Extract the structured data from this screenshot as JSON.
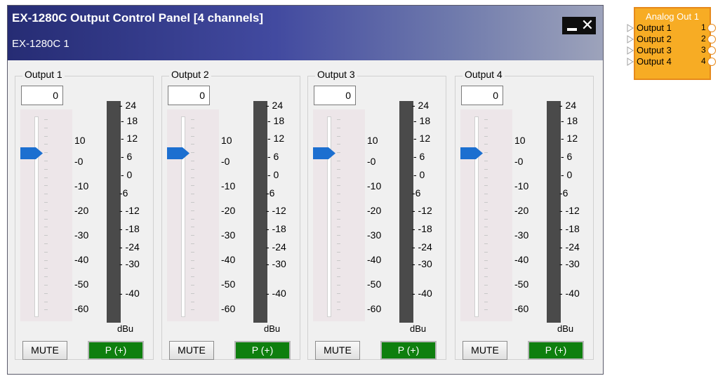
{
  "window": {
    "title": "EX-1280C Output Control Panel [4 channels]",
    "subtitle": "EX-1280C 1",
    "minimize_icon": "minimize-icon",
    "close_icon": "close-icon",
    "close_glyph": "✕"
  },
  "fader_scale": [
    "10",
    "-0",
    "-10",
    "-20",
    "-30",
    "-40",
    "-50",
    "-60"
  ],
  "meter_scale": [
    "- 24",
    "- 18",
    "- 12",
    "- 6",
    "- 0",
    "-6",
    "- -12",
    "- -18",
    "- -24",
    "- -30",
    "- -40"
  ],
  "meter_unit": "dBu",
  "colors": {
    "title_bar_start": "#262c74",
    "meter": "#4a4a4a",
    "polarity_on": "#0e7f0e",
    "fader_thumb": "#1c6fd0",
    "block": "#f7ac24"
  },
  "channels": [
    {
      "label": "Output 1",
      "gain_value": "0",
      "fader_level_db": 0,
      "mute_label": "MUTE",
      "polarity_label": "P (+)",
      "polarity_on": true
    },
    {
      "label": "Output 2",
      "gain_value": "0",
      "fader_level_db": 0,
      "mute_label": "MUTE",
      "polarity_label": "P (+)",
      "polarity_on": true
    },
    {
      "label": "Output 3",
      "gain_value": "0",
      "fader_level_db": 0,
      "mute_label": "MUTE",
      "polarity_label": "P (+)",
      "polarity_on": true
    },
    {
      "label": "Output 4",
      "gain_value": "0",
      "fader_level_db": 0,
      "mute_label": "MUTE",
      "polarity_label": "P (+)",
      "polarity_on": true
    }
  ],
  "block": {
    "title": "Analog Out 1",
    "outputs": [
      {
        "label": "Output 1",
        "number": "1"
      },
      {
        "label": "Output 2",
        "number": "2"
      },
      {
        "label": "Output 3",
        "number": "3"
      },
      {
        "label": "Output 4",
        "number": "4"
      }
    ]
  }
}
